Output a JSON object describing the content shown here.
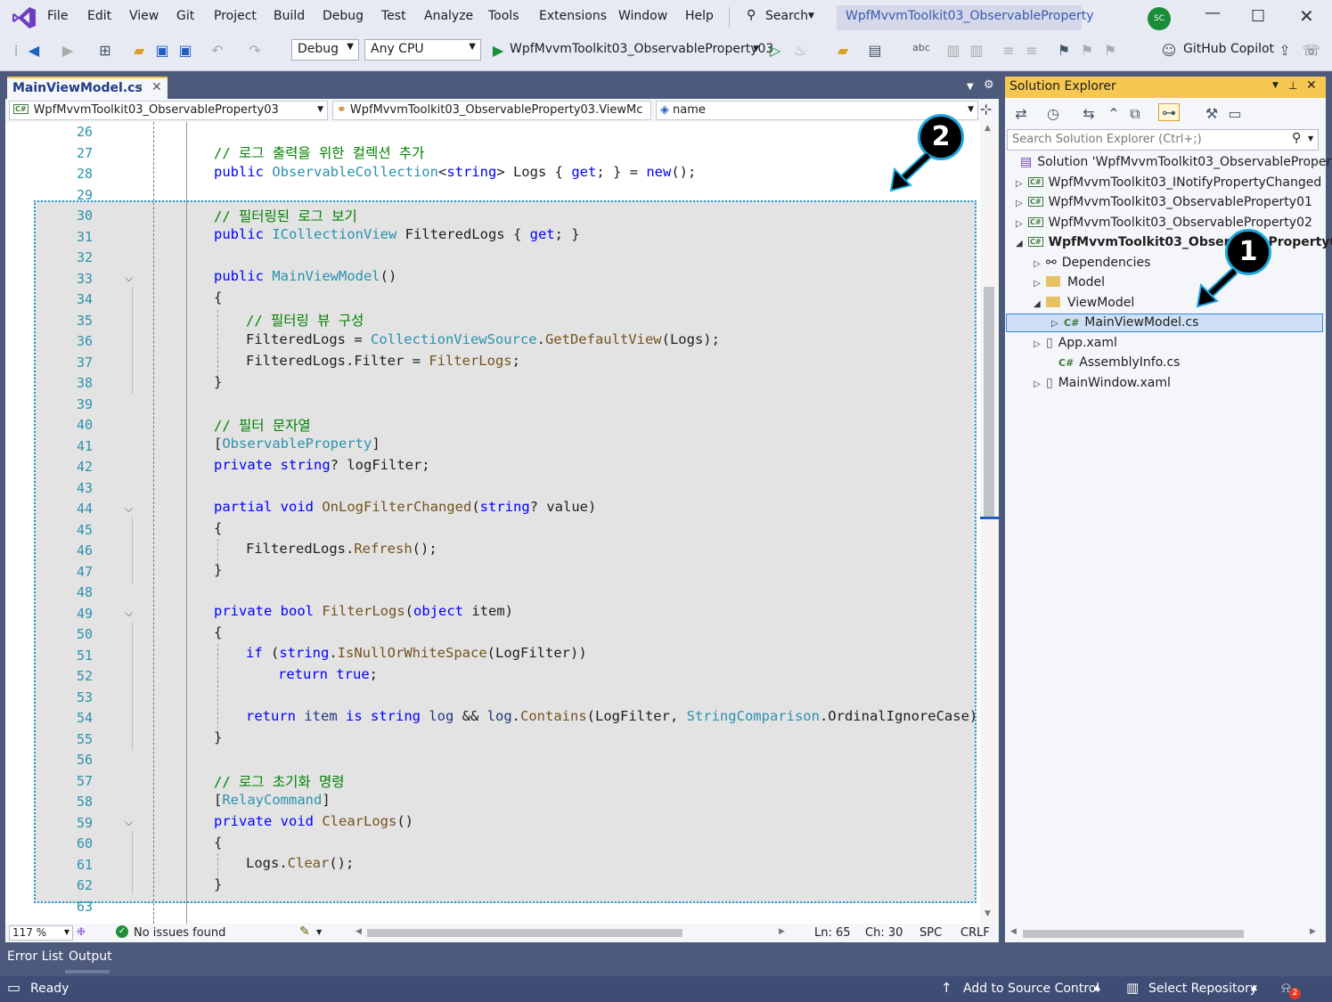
{
  "menu": {
    "items": [
      "File",
      "Edit",
      "View",
      "Git",
      "Project",
      "Build",
      "Debug",
      "Test",
      "Analyze",
      "Tools",
      "Extensions",
      "Window",
      "Help"
    ],
    "search_label": "Search",
    "title": "WpfMvvmToolkit03_ObservableProperty",
    "avatar": "SC"
  },
  "toolbar": {
    "config": "Debug",
    "platform": "Any CPU",
    "startup_project": "WpfMvvmToolkit03_ObservableProperty03",
    "copilot": "GitHub Copilot"
  },
  "editor": {
    "tab_label": "MainViewModel.cs",
    "nav_project": "WpfMvvmToolkit03_ObservableProperty03",
    "nav_class": "WpfMvvmToolkit03_ObservableProperty03.ViewMc",
    "nav_member": "name",
    "zoom": "117 %",
    "issues": "No issues found",
    "ln": "Ln: 65",
    "ch": "Ch: 30",
    "spc": "SPC",
    "crlf": "CRLF",
    "line_numbers": [
      "26",
      "27",
      "28",
      "29",
      "30",
      "31",
      "32",
      "33",
      "34",
      "35",
      "36",
      "37",
      "38",
      "39",
      "40",
      "41",
      "42",
      "43",
      "44",
      "45",
      "46",
      "47",
      "48",
      "49",
      "50",
      "51",
      "52",
      "53",
      "54",
      "55",
      "56",
      "57",
      "58",
      "59",
      "60",
      "61",
      "62",
      "63"
    ],
    "code": {
      "l27": "// 로그 출력을 위한 컬렉션 추가",
      "l28a": "public ",
      "l28b": "ObservableCollection",
      "l28c": "<",
      "l28d": "string",
      "l28e": "> Logs { ",
      "l28f": "get",
      "l28g": "; } = ",
      "l28h": "new",
      "l28i": "();",
      "l30": "// 필터링된 로그 보기",
      "l31a": "public ",
      "l31b": "ICollectionView",
      "l31c": " FilteredLogs { ",
      "l31d": "get",
      "l31e": "; }",
      "l33a": "public ",
      "l33b": "MainViewModel",
      "l33c": "()",
      "l34": "{",
      "l35": "// 필터링 뷰 구성",
      "l36a": "FilteredLogs = ",
      "l36b": "CollectionViewSource",
      "l36c": ".",
      "l36d": "GetDefaultView",
      "l36e": "(Logs);",
      "l37a": "FilteredLogs.Filter = ",
      "l37b": "FilterLogs",
      "l37c": ";",
      "l38": "}",
      "l40": "// 필터 문자열",
      "l41a": "[",
      "l41b": "ObservableProperty",
      "l41c": "]",
      "l42a": "private ",
      "l42b": "string",
      "l42c": "? logFilter;",
      "l44a": "partial ",
      "l44b": "void ",
      "l44c": "OnLogFilterChanged",
      "l44d": "(",
      "l44e": "string",
      "l44f": "? value)",
      "l45": "{",
      "l46a": "FilteredLogs.",
      "l46b": "Refresh",
      "l46c": "();",
      "l47": "}",
      "l49a": "private ",
      "l49b": "bool ",
      "l49c": "FilterLogs",
      "l49d": "(",
      "l49e": "object",
      "l49f": " item)",
      "l50": "{",
      "l51a": "if ",
      "l51b": "(",
      "l51c": "string",
      "l51d": ".",
      "l51e": "IsNullOrWhiteSpace",
      "l51f": "(LogFilter))",
      "l52a": "return ",
      "l52b": "true",
      "l52c": ";",
      "l54a": "return ",
      "l54b": "item ",
      "l54c": "is ",
      "l54d": "string ",
      "l54e": "log ",
      "l54f": "&& ",
      "l54g": "log",
      "l54h": ".",
      "l54i": "Contains",
      "l54j": "(LogFilter, ",
      "l54k": "StringComparison",
      "l54l": ".OrdinalIgnoreCase);",
      "l55": "}",
      "l57": "// 로그 초기화 명령",
      "l58a": "[",
      "l58b": "RelayCommand",
      "l58c": "]",
      "l59a": "private ",
      "l59b": "void ",
      "l59c": "ClearLogs",
      "l59d": "()",
      "l60": "{",
      "l61a": "Logs.",
      "l61b": "Clear",
      "l61c": "();",
      "l62": "}"
    }
  },
  "solution_explorer": {
    "title": "Solution Explorer",
    "search_placeholder": "Search Solution Explorer (Ctrl+;)",
    "items": [
      "Solution 'WpfMvvmToolkit03_ObservableProperty'",
      "WpfMvvmToolkit03_INotifyPropertyChanged",
      "WpfMvvmToolkit03_ObservableProperty01",
      "WpfMvvmToolkit03_ObservableProperty02",
      "WpfMvvmToolkit03_ObservableProperty03",
      "Dependencies",
      "Model",
      "ViewModel",
      "MainViewModel.cs",
      "App.xaml",
      "AssemblyInfo.cs",
      "MainWindow.xaml"
    ]
  },
  "bottom_tabs": [
    "Error List",
    "Output"
  ],
  "status": {
    "ready": "Ready",
    "add_source": "Add to Source Control",
    "select_repo": "Select Repository",
    "notif_count": "2"
  },
  "badges": [
    "1",
    "2"
  ]
}
